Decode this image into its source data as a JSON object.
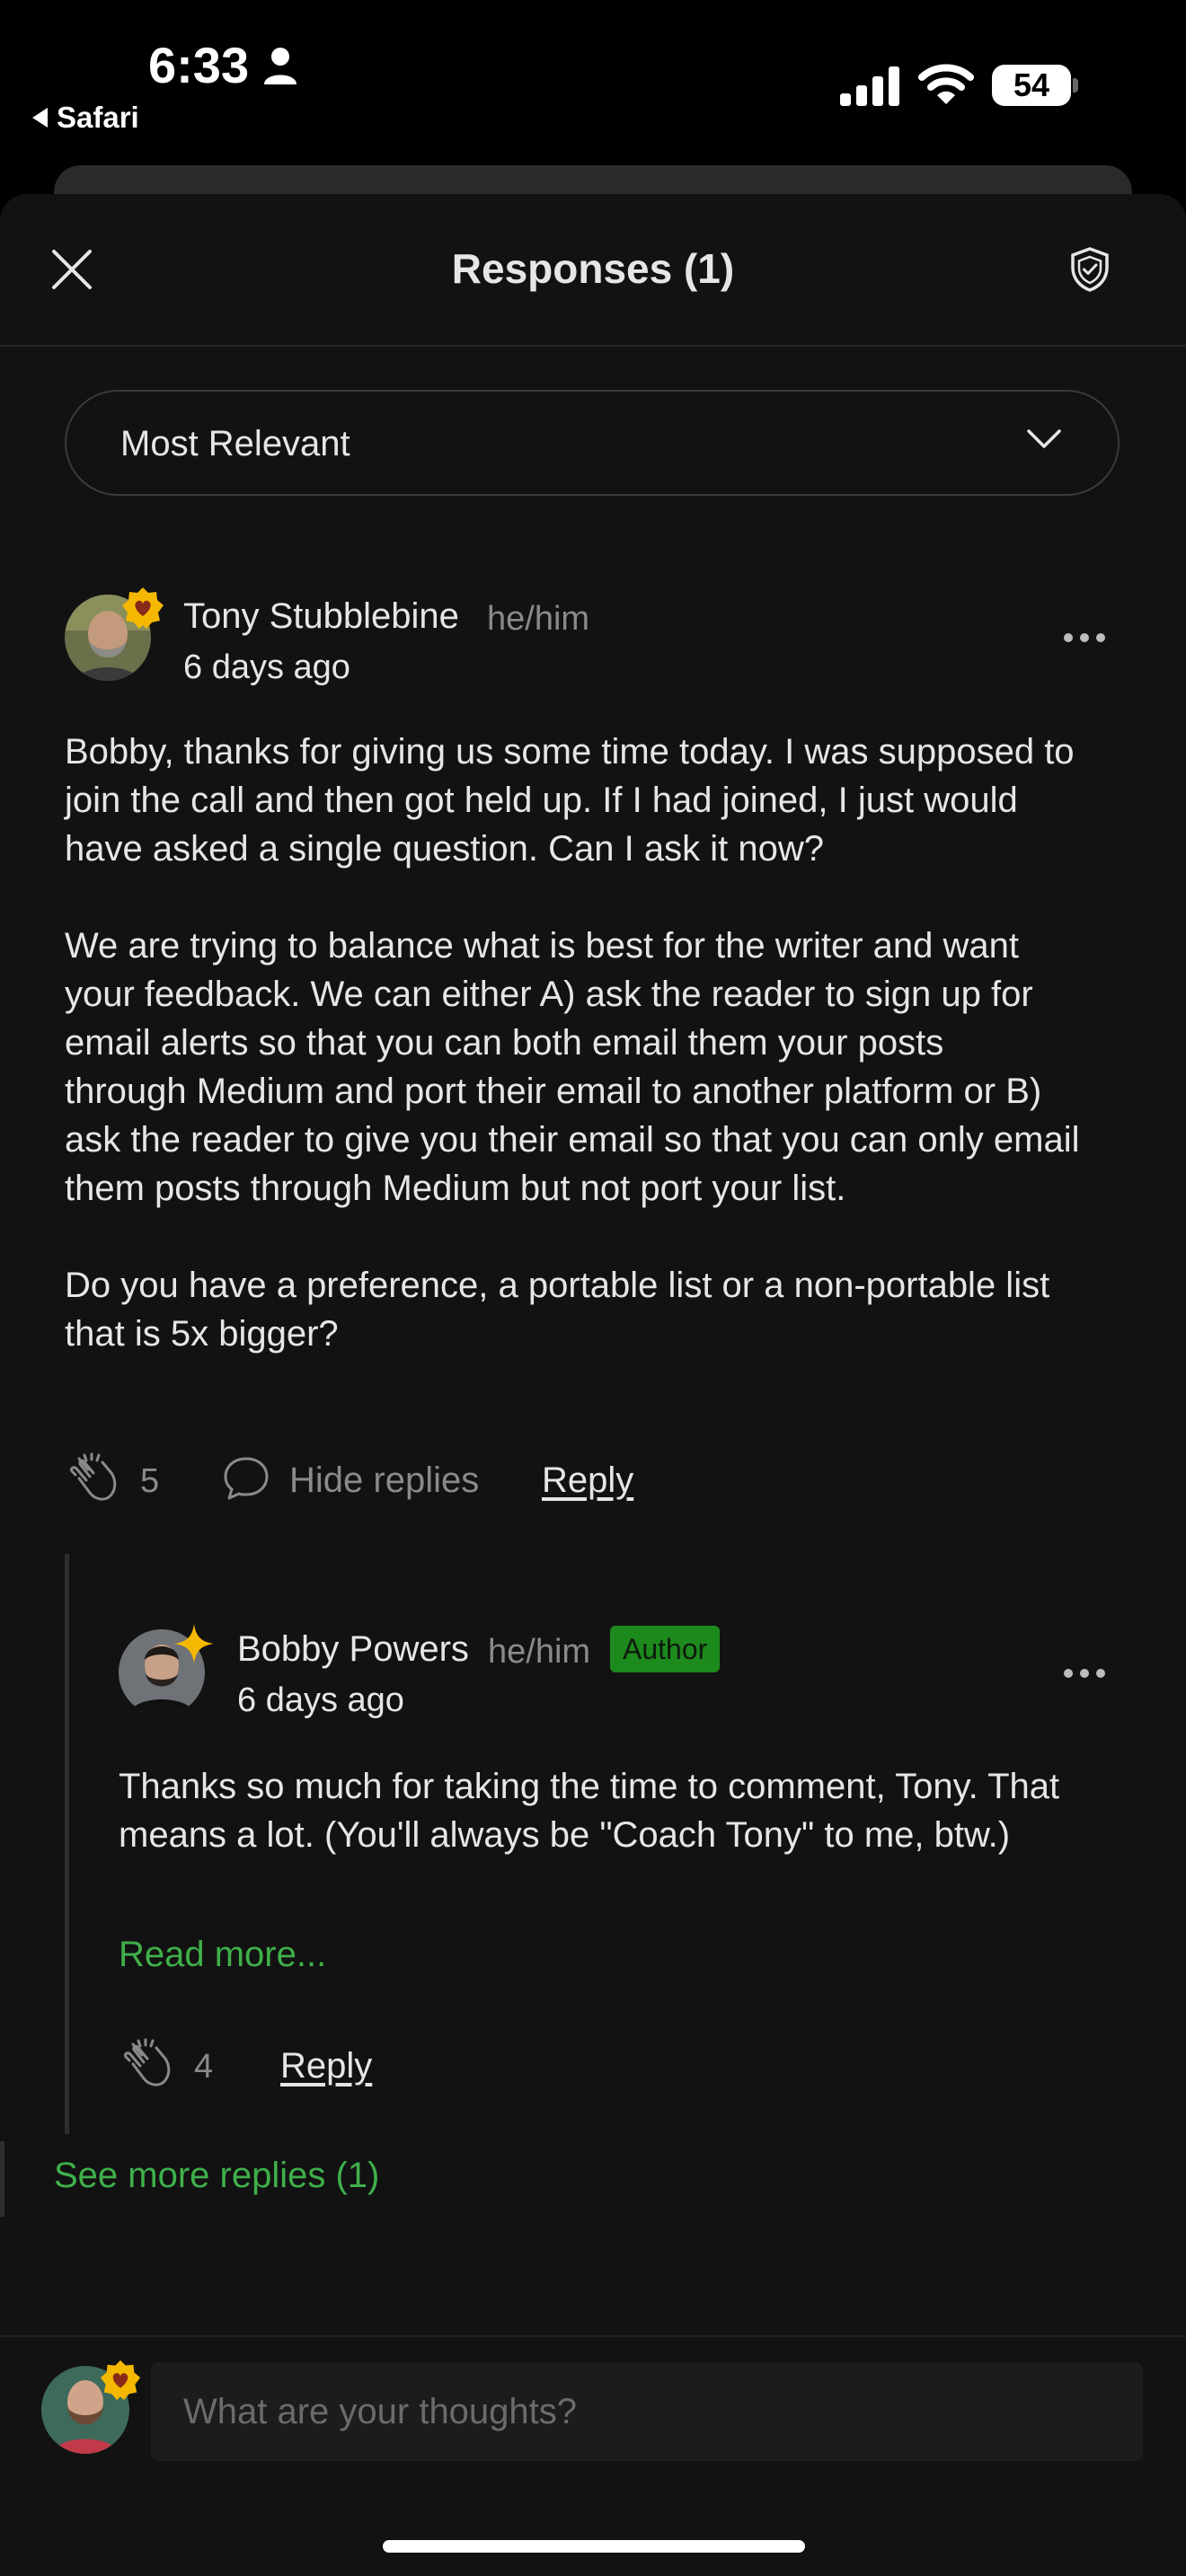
{
  "status_bar": {
    "time": "6:33",
    "back_app": "Safari",
    "battery": "54"
  },
  "header": {
    "title": "Responses (1)"
  },
  "sort": {
    "selected": "Most Relevant"
  },
  "comment": {
    "author": "Tony Stubblebine",
    "pronouns": "he/him",
    "time": "6 days ago",
    "body": "Bobby, thanks for giving us some time today. I was supposed to\njoin the call and then got held up. If I had joined, I just would\nhave asked a single question. Can I ask it now?\n\nWe are trying to balance what is best for the writer and want\nyour feedback. We can either A) ask the reader to sign up for\nemail alerts so that you can both email them your posts\nthrough Medium and port their email to another platform or B)\nask the reader to give you their email so that you can only email\nthem posts through Medium but not port your list.\n\nDo you have a preference, a portable list or a non-portable list\nthat is 5x bigger?",
    "claps": "5",
    "hide_replies_label": "Hide replies",
    "reply_label": "Reply"
  },
  "reply": {
    "author": "Bobby Powers",
    "pronouns": "he/him",
    "badge": "Author",
    "time": "6 days ago",
    "body": "Thanks so much for taking the time to comment, Tony. That\nmeans a lot. (You'll always be \"Coach Tony\" to me, btw.)",
    "read_more": "Read more...",
    "claps": "4",
    "reply_label": "Reply"
  },
  "see_more_replies": "See more replies (1)",
  "composer": {
    "placeholder": "What are your thoughts?"
  },
  "colors": {
    "accent_green": "#3fb04a",
    "badge_gold": "#f5b800",
    "background": "#121212"
  },
  "icons": [
    "person-icon",
    "signal-icon",
    "wifi-icon",
    "close-icon",
    "shield-icon",
    "chevron-down-icon",
    "more-icon",
    "clap-icon",
    "speech-bubble-icon",
    "membership-badge-icon",
    "star-badge-icon"
  ]
}
